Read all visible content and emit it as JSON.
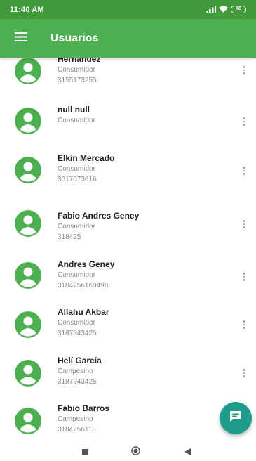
{
  "status_bar": {
    "time": "11:40 AM",
    "battery": "48"
  },
  "app_bar": {
    "title": "Usuarios"
  },
  "users": [
    {
      "name": "Hernandez",
      "role": "Consumidor",
      "phone": "3155173255"
    },
    {
      "name": "null null",
      "role": "Consumidor",
      "phone": ""
    },
    {
      "name": "Elkin Mercado",
      "role": "Consumidor",
      "phone": "3017073616"
    },
    {
      "name": "Fabio Andres Geney",
      "role": "Consumidor",
      "phone": "318425"
    },
    {
      "name": "Andres Geney",
      "role": "Consumidor",
      "phone": "3184256169498"
    },
    {
      "name": "Allahu  Akbar",
      "role": "Consumidor",
      "phone": "3187943425"
    },
    {
      "name": "Helí García",
      "role": "Campesino",
      "phone": "3187943425"
    },
    {
      "name": "Fabio  Barros",
      "role": "Campesino",
      "phone": "3184256113"
    }
  ],
  "colors": {
    "status_bar": "#3f9b3a",
    "app_bar": "#4caf50",
    "avatar": "#4caf50",
    "fab": "#1e9c8a"
  },
  "icons": {
    "menu": "hamburger-menu-icon",
    "avatar": "account-circle-icon",
    "more": "more-vertical-icon",
    "fab": "message-icon",
    "nav_recents": "square-icon",
    "nav_home": "circle-icon",
    "nav_back": "triangle-back-icon"
  }
}
